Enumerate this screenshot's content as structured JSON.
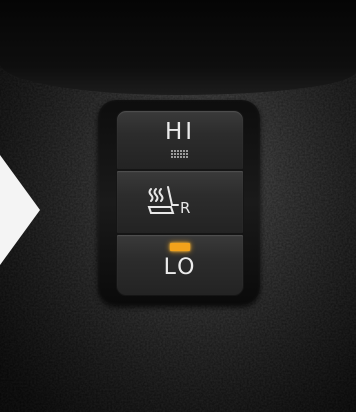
{
  "panel": {
    "hi_label": "HI",
    "lo_label": "LO",
    "seat_suffix": "R"
  },
  "icons": {
    "hi_indicator": "heater-grid-icon",
    "seat": "seat-heater-icon",
    "lo_indicator": "amber-indicator-light"
  },
  "colors": {
    "indicator_lo": "#f3a21b",
    "button_face": "#2c2c2c",
    "label_text": "#ececec"
  },
  "state": {
    "active_level": "LO"
  }
}
